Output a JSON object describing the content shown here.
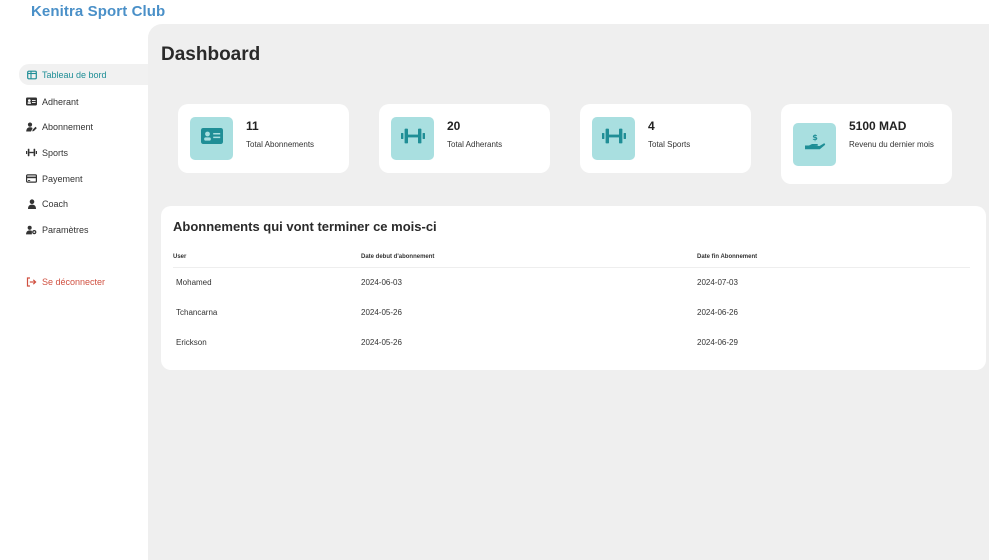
{
  "app": {
    "brand": "Kenitra Sport Club"
  },
  "colors": {
    "accent": "#1f8e96",
    "badge_bg": "#a9dfe0",
    "brand": "#4a90c8",
    "logout": "#d05040"
  },
  "sidebar": {
    "items": [
      {
        "label": "Tableau de bord",
        "icon": "dashboard-icon",
        "active": true
      },
      {
        "label": "Adherant",
        "icon": "id-card-icon"
      },
      {
        "label": "Abonnement",
        "icon": "user-edit-icon"
      },
      {
        "label": "Sports",
        "icon": "dumbbell-icon"
      },
      {
        "label": "Payement",
        "icon": "credit-card-icon"
      },
      {
        "label": "Coach",
        "icon": "user-icon"
      },
      {
        "label": "Paramètres",
        "icon": "user-gear-icon"
      }
    ],
    "logout": {
      "label": "Se déconnecter",
      "icon": "logout-icon"
    }
  },
  "main": {
    "title": "Dashboard"
  },
  "cards": [
    {
      "value": "11",
      "label": "Total Abonnements",
      "icon": "id-card-icon"
    },
    {
      "value": "20",
      "label": "Total Adherants",
      "icon": "dumbbell-icon"
    },
    {
      "value": "4",
      "label": "Total Sports",
      "icon": "dumbbell-icon"
    },
    {
      "value": "5100 MAD",
      "label": "Revenu du dernier mois",
      "icon": "hand-dollar-icon"
    }
  ],
  "table": {
    "title": "Abonnements qui vont terminer ce mois-ci",
    "headers": [
      "User",
      "Date debut d'abonnement",
      "Date fin Abonnement"
    ],
    "rows": [
      [
        "Mohamed",
        "2024-06-03",
        "2024-07-03"
      ],
      [
        "Tchancarna",
        "2024-05-26",
        "2024-06-26"
      ],
      [
        "Erickson",
        "2024-05-26",
        "2024-06-29"
      ]
    ]
  }
}
